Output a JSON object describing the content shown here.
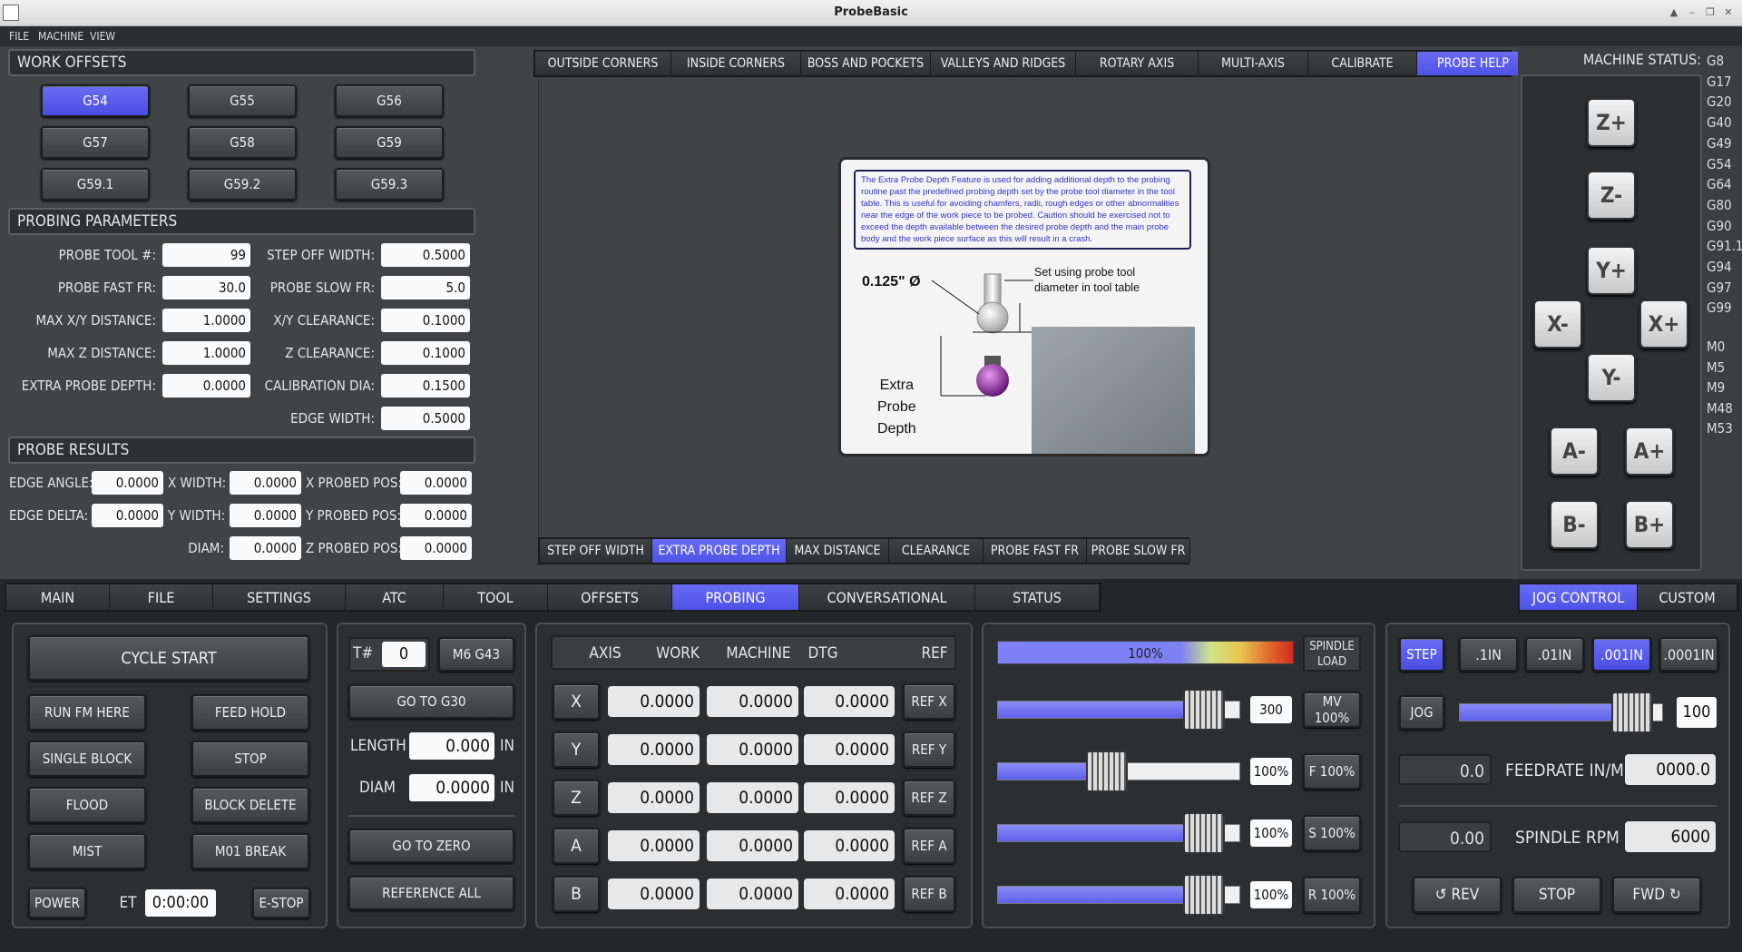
{
  "window": {
    "title": "ProbeBasic"
  },
  "menu": [
    "FILE",
    "MACHINE",
    "VIEW"
  ],
  "work_offsets": {
    "header": "WORK OFFSETS",
    "buttons": [
      "G54",
      "G55",
      "G56",
      "G57",
      "G58",
      "G59",
      "G59.1",
      "G59.2",
      "G59.3"
    ],
    "active": "G54"
  },
  "probing_params": {
    "header": "PROBING PARAMETERS",
    "left": [
      {
        "label": "PROBE TOOL #:",
        "value": "99"
      },
      {
        "label": "PROBE FAST FR:",
        "value": "30.0"
      },
      {
        "label": "MAX X/Y DISTANCE:",
        "value": "1.0000"
      },
      {
        "label": "MAX Z DISTANCE:",
        "value": "1.0000"
      },
      {
        "label": "EXTRA PROBE DEPTH:",
        "value": "0.0000"
      }
    ],
    "right": [
      {
        "label": "STEP OFF WIDTH:",
        "value": "0.5000"
      },
      {
        "label": "PROBE SLOW FR:",
        "value": "5.0"
      },
      {
        "label": "X/Y CLEARANCE:",
        "value": "0.1000"
      },
      {
        "label": "Z CLEARANCE:",
        "value": "0.1000"
      },
      {
        "label": "CALIBRATION DIA:",
        "value": "0.1500"
      },
      {
        "label": "EDGE WIDTH:",
        "value": "0.5000"
      }
    ]
  },
  "probe_results": {
    "header": "PROBE RESULTS",
    "edge_angle": {
      "label": "EDGE ANGLE:",
      "value": "0.0000"
    },
    "edge_delta": {
      "label": "EDGE DELTA:",
      "value": "0.0000"
    },
    "x_width": {
      "label": "X WIDTH:",
      "value": "0.0000"
    },
    "y_width": {
      "label": "Y WIDTH:",
      "value": "0.0000"
    },
    "diam": {
      "label": "DIAM:",
      "value": "0.0000"
    },
    "x_pos": {
      "label": "X PROBED POS:",
      "value": "0.0000"
    },
    "y_pos": {
      "label": "Y PROBED POS:",
      "value": "0.0000"
    },
    "z_pos": {
      "label": "Z PROBED POS:",
      "value": "0.0000"
    }
  },
  "probe_tabs": [
    "OUTSIDE CORNERS",
    "INSIDE CORNERS",
    "BOSS AND POCKETS",
    "VALLEYS AND RIDGES",
    "ROTARY AXIS",
    "MULTI-AXIS",
    "CALIBRATE",
    "PROBE HELP"
  ],
  "probe_tabs_active": "PROBE HELP",
  "help": {
    "text": "The Extra Probe Depth Feature is used for adding additional depth to the probing routine past the predefined probing depth set by the probe tool diameter in the tool table.  This is useful for avoiding chamfers, radii, rough edges or other abnormalities near the edge of the work piece to be probed.  Caution should be exercised not to exceed the depth available between the desired probe depth and the main probe body and the work piece surface as this will result in a crash.",
    "dia_label": "0.125\" Ø",
    "set_note_1": "Set using probe tool",
    "set_note_2": "diameter in tool table",
    "extra_1": "Extra",
    "extra_2": "Probe",
    "extra_3": "Depth"
  },
  "help_tabs": [
    "STEP OFF WIDTH",
    "EXTRA PROBE DEPTH",
    "MAX DISTANCE",
    "CLEARANCE",
    "PROBE FAST FR",
    "PROBE SLOW FR"
  ],
  "help_tabs_active": "EXTRA PROBE DEPTH",
  "machine_status": {
    "label": "MACHINE STATUS:",
    "gcodes": [
      "G8",
      "G17",
      "G20",
      "G40",
      "G49",
      "G54",
      "G64",
      "G80",
      "G90",
      "G91.1",
      "G94",
      "G97",
      "G99"
    ],
    "mcodes": [
      "M0",
      "M5",
      "M9",
      "M48",
      "M53"
    ]
  },
  "jog_buttons": {
    "zp": "Z+",
    "zm": "Z-",
    "yp": "Y+",
    "ym": "Y-",
    "xm": "X-",
    "xp": "X+",
    "am": "A-",
    "ap": "A+",
    "bm": "B-",
    "bp": "B+"
  },
  "main_tabs": [
    "MAIN",
    "FILE",
    "SETTINGS",
    "ATC",
    "TOOL",
    "OFFSETS",
    "PROBING",
    "CONVERSATIONAL",
    "STATUS"
  ],
  "main_tabs_active": "PROBING",
  "right_tabs": [
    "JOG CONTROL",
    "CUSTOM"
  ],
  "right_tabs_active": "JOG CONTROL",
  "controls": {
    "cycle_start": "CYCLE START",
    "run_from_here": "RUN FM HERE",
    "feed_hold": "FEED HOLD",
    "single_block": "SINGLE BLOCK",
    "stop": "STOP",
    "flood": "FLOOD",
    "block_delete": "BLOCK DELETE",
    "mist": "MIST",
    "m01_break": "M01 BREAK",
    "power": "POWER",
    "et_label": "ET",
    "et_value": "0:00:00",
    "estop": "E-STOP"
  },
  "tool": {
    "t_label": "T#",
    "t_value": "0",
    "m6": "M6 G43",
    "go_g30": "GO TO G30",
    "length_label": "LENGTH",
    "length_value": "0.000",
    "diam_label": "DIAM",
    "diam_value": "0.0000",
    "unit": "IN",
    "go_zero": "GO TO ZERO",
    "ref_all": "REFERENCE ALL"
  },
  "dro": {
    "headers": [
      "AXIS",
      "WORK",
      "MACHINE",
      "DTG",
      "REF"
    ],
    "rows": [
      {
        "axis": "X",
        "work": "0.0000",
        "machine": "0.0000",
        "dtg": "0.0000",
        "ref": "REF X"
      },
      {
        "axis": "Y",
        "work": "0.0000",
        "machine": "0.0000",
        "dtg": "0.0000",
        "ref": "REF Y"
      },
      {
        "axis": "Z",
        "work": "0.0000",
        "machine": "0.0000",
        "dtg": "0.0000",
        "ref": "REF Z"
      },
      {
        "axis": "A",
        "work": "0.0000",
        "machine": "0.0000",
        "dtg": "0.0000",
        "ref": "REF A"
      },
      {
        "axis": "B",
        "work": "0.0000",
        "machine": "0.0000",
        "dtg": "0.0000",
        "ref": "REF B"
      }
    ]
  },
  "overrides": {
    "spindle_load_pct": "100%",
    "spindle_load_label_1": "SPINDLE",
    "spindle_load_label_2": "LOAD",
    "rows": [
      {
        "value": "300",
        "button": "MV 100%",
        "level": 0.85
      },
      {
        "value": "100%",
        "button": "F 100%",
        "level": 0.45
      },
      {
        "value": "100%",
        "button": "S 100%",
        "level": 0.85
      },
      {
        "value": "100%",
        "button": "R 100%",
        "level": 0.85
      }
    ]
  },
  "jog": {
    "step": "STEP",
    "increments": [
      ".1IN",
      ".01IN",
      ".001IN",
      ".0001IN"
    ],
    "active_increment": ".001IN",
    "jog": "JOG",
    "jog_value": "100",
    "jog_level": 0.85,
    "feed_actual": "0.0",
    "feed_label": "FEEDRATE IN/M",
    "feed_set": "0000.0",
    "rpm_actual": "0.00",
    "rpm_label": "SPINDLE RPM",
    "rpm_set": "6000",
    "rev": "↺ REV",
    "stop": "STOP",
    "fwd": "FWD ↻"
  }
}
